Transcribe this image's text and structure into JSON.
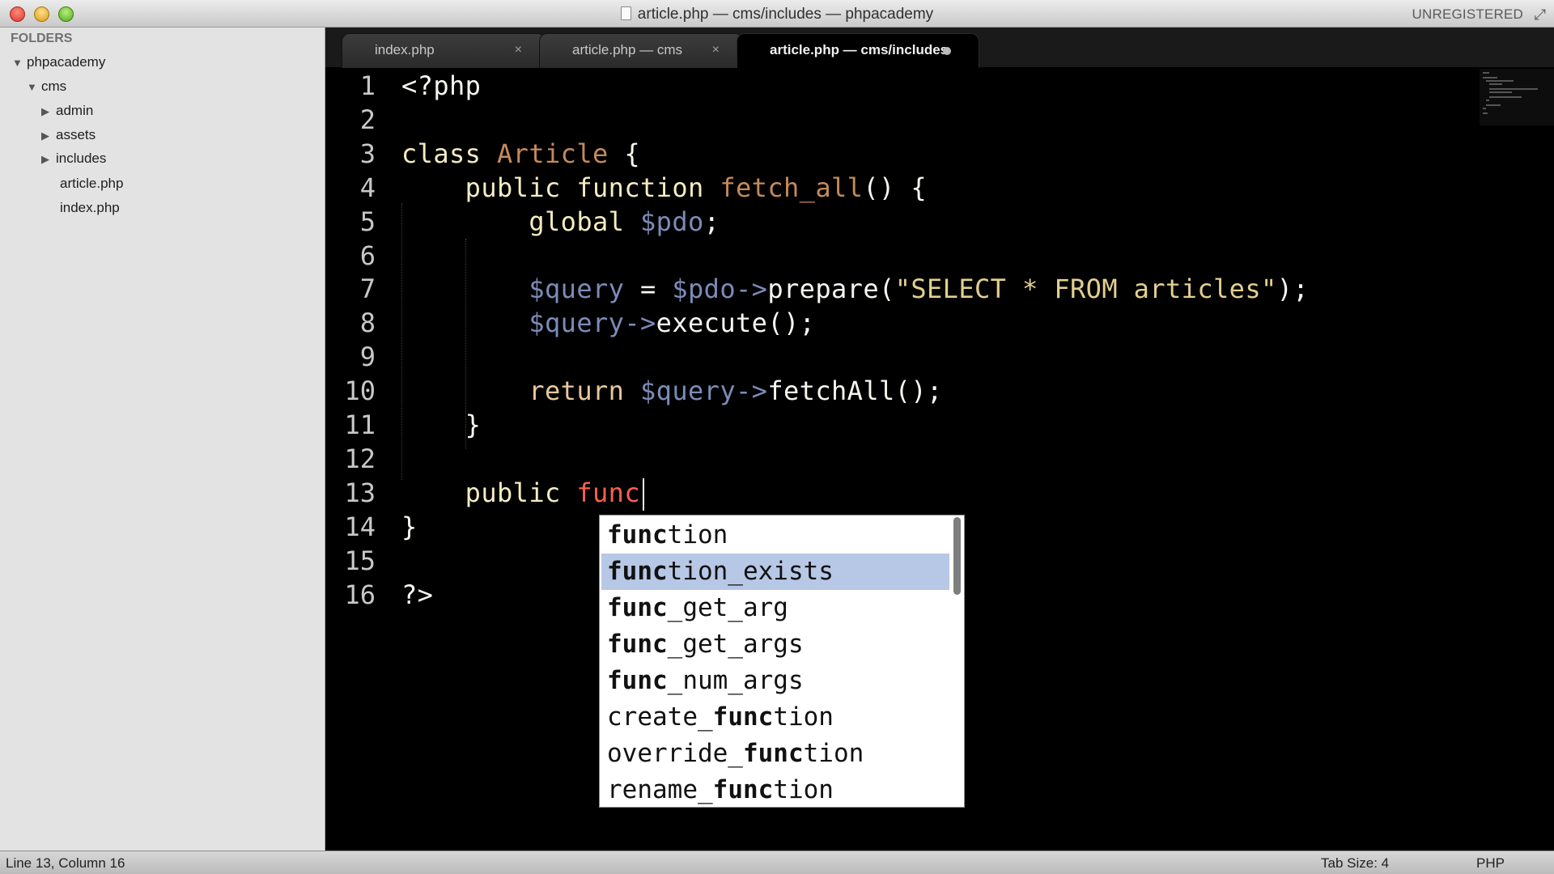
{
  "window": {
    "title": "article.php — cms/includes — phpacademy",
    "license": "UNREGISTERED"
  },
  "sidebar": {
    "header": "FOLDERS",
    "tree": [
      {
        "label": "phpacademy",
        "type": "folder",
        "expanded": true,
        "depth": 0
      },
      {
        "label": "cms",
        "type": "folder",
        "expanded": true,
        "depth": 1
      },
      {
        "label": "admin",
        "type": "folder",
        "expanded": false,
        "depth": 2
      },
      {
        "label": "assets",
        "type": "folder",
        "expanded": false,
        "depth": 2
      },
      {
        "label": "includes",
        "type": "folder",
        "expanded": false,
        "depth": 2
      },
      {
        "label": "article.php",
        "type": "file",
        "depth": 2
      },
      {
        "label": "index.php",
        "type": "file",
        "depth": 2
      }
    ]
  },
  "tabs": [
    {
      "label": "index.php",
      "active": false,
      "close": "×"
    },
    {
      "label": "article.php — cms",
      "active": false,
      "close": "×"
    },
    {
      "label": "article.php — cms/includes",
      "active": true,
      "modified": true
    }
  ],
  "editor": {
    "lines": [
      {
        "n": "1",
        "code": "<?php"
      },
      {
        "n": "2",
        "code": ""
      },
      {
        "n": "3",
        "code": "class Article {"
      },
      {
        "n": "4",
        "code": "    public function fetch_all() {"
      },
      {
        "n": "5",
        "code": "        global $pdo;"
      },
      {
        "n": "6",
        "code": ""
      },
      {
        "n": "7",
        "code": "        $query = $pdo->prepare(\"SELECT * FROM articles\");"
      },
      {
        "n": "8",
        "code": "        $query->execute();"
      },
      {
        "n": "9",
        "code": ""
      },
      {
        "n": "10",
        "code": "        return $query->fetchAll();"
      },
      {
        "n": "11",
        "code": "    }"
      },
      {
        "n": "12",
        "code": ""
      },
      {
        "n": "13",
        "code": "    public func"
      },
      {
        "n": "14",
        "code": "}"
      },
      {
        "n": "15",
        "code": ""
      },
      {
        "n": "16",
        "code": "?>"
      }
    ]
  },
  "autocomplete": {
    "typed": "func",
    "selected_index": 1,
    "items": [
      "function",
      "function_exists",
      "func_get_arg",
      "func_get_args",
      "func_num_args",
      "create_function",
      "override_function",
      "rename_function"
    ]
  },
  "status": {
    "position": "Line 13, Column 16",
    "tab_size": "Tab Size: 4",
    "syntax": "PHP"
  },
  "colors": {
    "editor_bg": "#000000",
    "selection": "#b7c7e6",
    "keyword": "#f4ecc0",
    "class_name": "#c48a5a",
    "variable": "#7c8cb8",
    "string": "#e3cf8f",
    "typing": "#ff5e4d"
  }
}
